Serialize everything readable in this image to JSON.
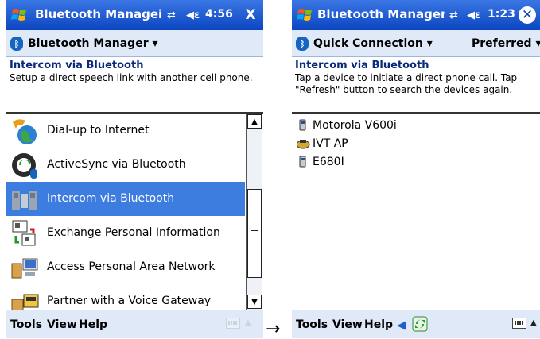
{
  "left_screen": {
    "title": "Bluetooth Managei",
    "status_icon": "connectivity-icon",
    "time": "4:56",
    "close_label": "X",
    "nav_label": "Bluetooth Manager",
    "info_title": "Intercom via Bluetooth",
    "info_text": "Setup a direct speech link with another cell phone.",
    "services": [
      {
        "label": "Dial-up to Internet",
        "icon": "dialup-icon"
      },
      {
        "label": "ActiveSync via Bluetooth",
        "icon": "activesync-icon"
      },
      {
        "label": "Intercom via Bluetooth",
        "icon": "intercom-icon",
        "selected": true
      },
      {
        "label": "Exchange Personal Information",
        "icon": "exchange-icon"
      },
      {
        "label": "Access Personal Area Network",
        "icon": "network-icon"
      },
      {
        "label": "Partner with a Voice Gateway",
        "icon": "voice-gateway-icon"
      }
    ],
    "menu": [
      "Tools",
      "View",
      "Help"
    ]
  },
  "right_screen": {
    "title": "Bluetooth Manager",
    "time": "1:23",
    "nav_label": "Quick Connection",
    "nav_right": "Preferred",
    "info_title": "Intercom via Bluetooth",
    "info_text": "Tap a device to initiate a direct phone call. Tap \"Refresh\" button to search the devices again.",
    "devices": [
      {
        "label": "Motorola V600i",
        "icon": "phone-icon"
      },
      {
        "label": "IVT AP",
        "icon": "access-point-icon"
      },
      {
        "label": "E680I",
        "icon": "phone-icon"
      }
    ],
    "menu": [
      "Tools",
      "View",
      "Help"
    ]
  },
  "arrow": "→"
}
